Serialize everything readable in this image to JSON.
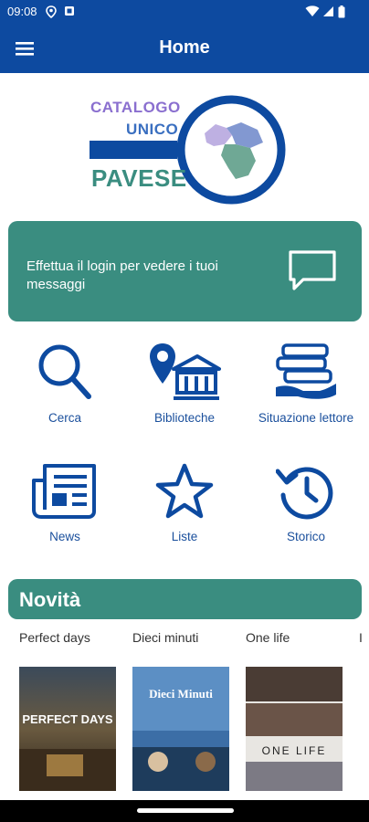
{
  "status_bar": {
    "time": "09:08"
  },
  "app_bar": {
    "title": "Home"
  },
  "logo": {
    "line1": "CATALOGO",
    "line2": "UNICO",
    "line3": "PAVESE"
  },
  "message_card": {
    "text": "Effettua il login per vedere i tuoi messaggi"
  },
  "grid": [
    {
      "label": "Cerca",
      "icon": "search-icon"
    },
    {
      "label": "Biblioteche",
      "icon": "library-location-icon"
    },
    {
      "label": "Situazione lettore",
      "icon": "books-hand-icon"
    },
    {
      "label": "News",
      "icon": "newspaper-icon"
    },
    {
      "label": "Liste",
      "icon": "star-icon"
    },
    {
      "label": "Storico",
      "icon": "history-icon"
    }
  ],
  "novita": {
    "title": "Novità",
    "books": [
      {
        "title": "Perfect days",
        "cover_text": "PERFECT DAYS"
      },
      {
        "title": "Dieci minuti",
        "cover_text": "Dieci Minuti"
      },
      {
        "title": "One life",
        "cover_text": "ONE LIFE"
      }
    ]
  },
  "colors": {
    "primary": "#0d4aa0",
    "accent": "#3a8d80"
  }
}
